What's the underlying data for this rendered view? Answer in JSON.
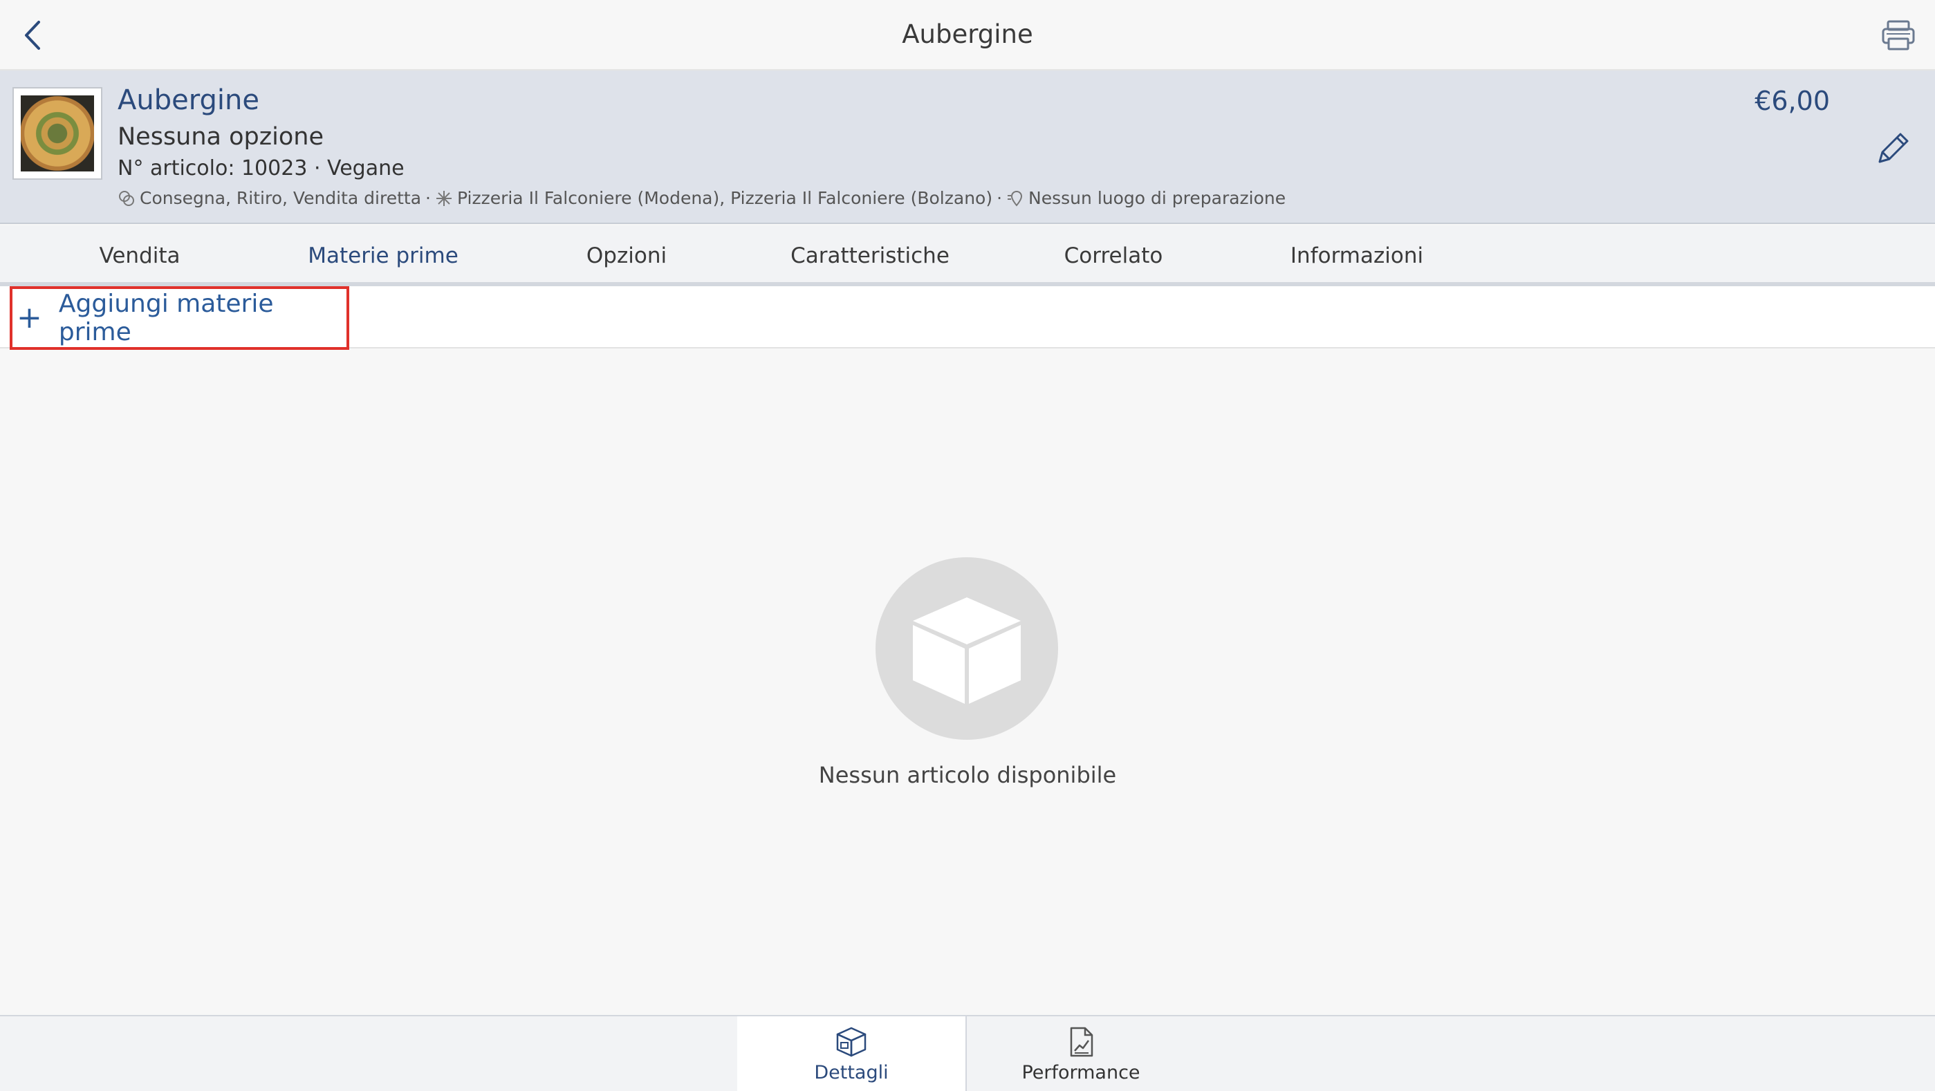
{
  "topbar": {
    "title": "Aubergine",
    "back_icon": "chevron-left-icon",
    "printer_icon": "printer-icon"
  },
  "item": {
    "name": "Aubergine",
    "option": "Nessuna opzione",
    "meta": "N° articolo: 10023 · Vegane",
    "channels": "Consegna, Ritiro, Vendita diretta",
    "locations": "Pizzeria Il Falconiere (Modena), Pizzeria Il Falconiere (Bolzano)",
    "prep": "Nessun luogo di preparazione",
    "separator": "·",
    "price": "€6,00"
  },
  "tabs": [
    {
      "label": "Vendita",
      "active": false
    },
    {
      "label": "Materie prime",
      "active": true
    },
    {
      "label": "Opzioni",
      "active": false
    },
    {
      "label": "Caratteristiche",
      "active": false
    },
    {
      "label": "Correlato",
      "active": false
    },
    {
      "label": "Informazioni",
      "active": false
    }
  ],
  "add": {
    "plus": "+",
    "label": "Aggiungi materie prime"
  },
  "empty": {
    "icon": "box-icon",
    "text": "Nessun articolo disponibile"
  },
  "bottom": {
    "details_label": "Dettagli",
    "performance_label": "Performance"
  },
  "colors": {
    "accent": "#2b4a7c",
    "highlight": "#e0312b",
    "header_bg": "#dee2ea"
  }
}
